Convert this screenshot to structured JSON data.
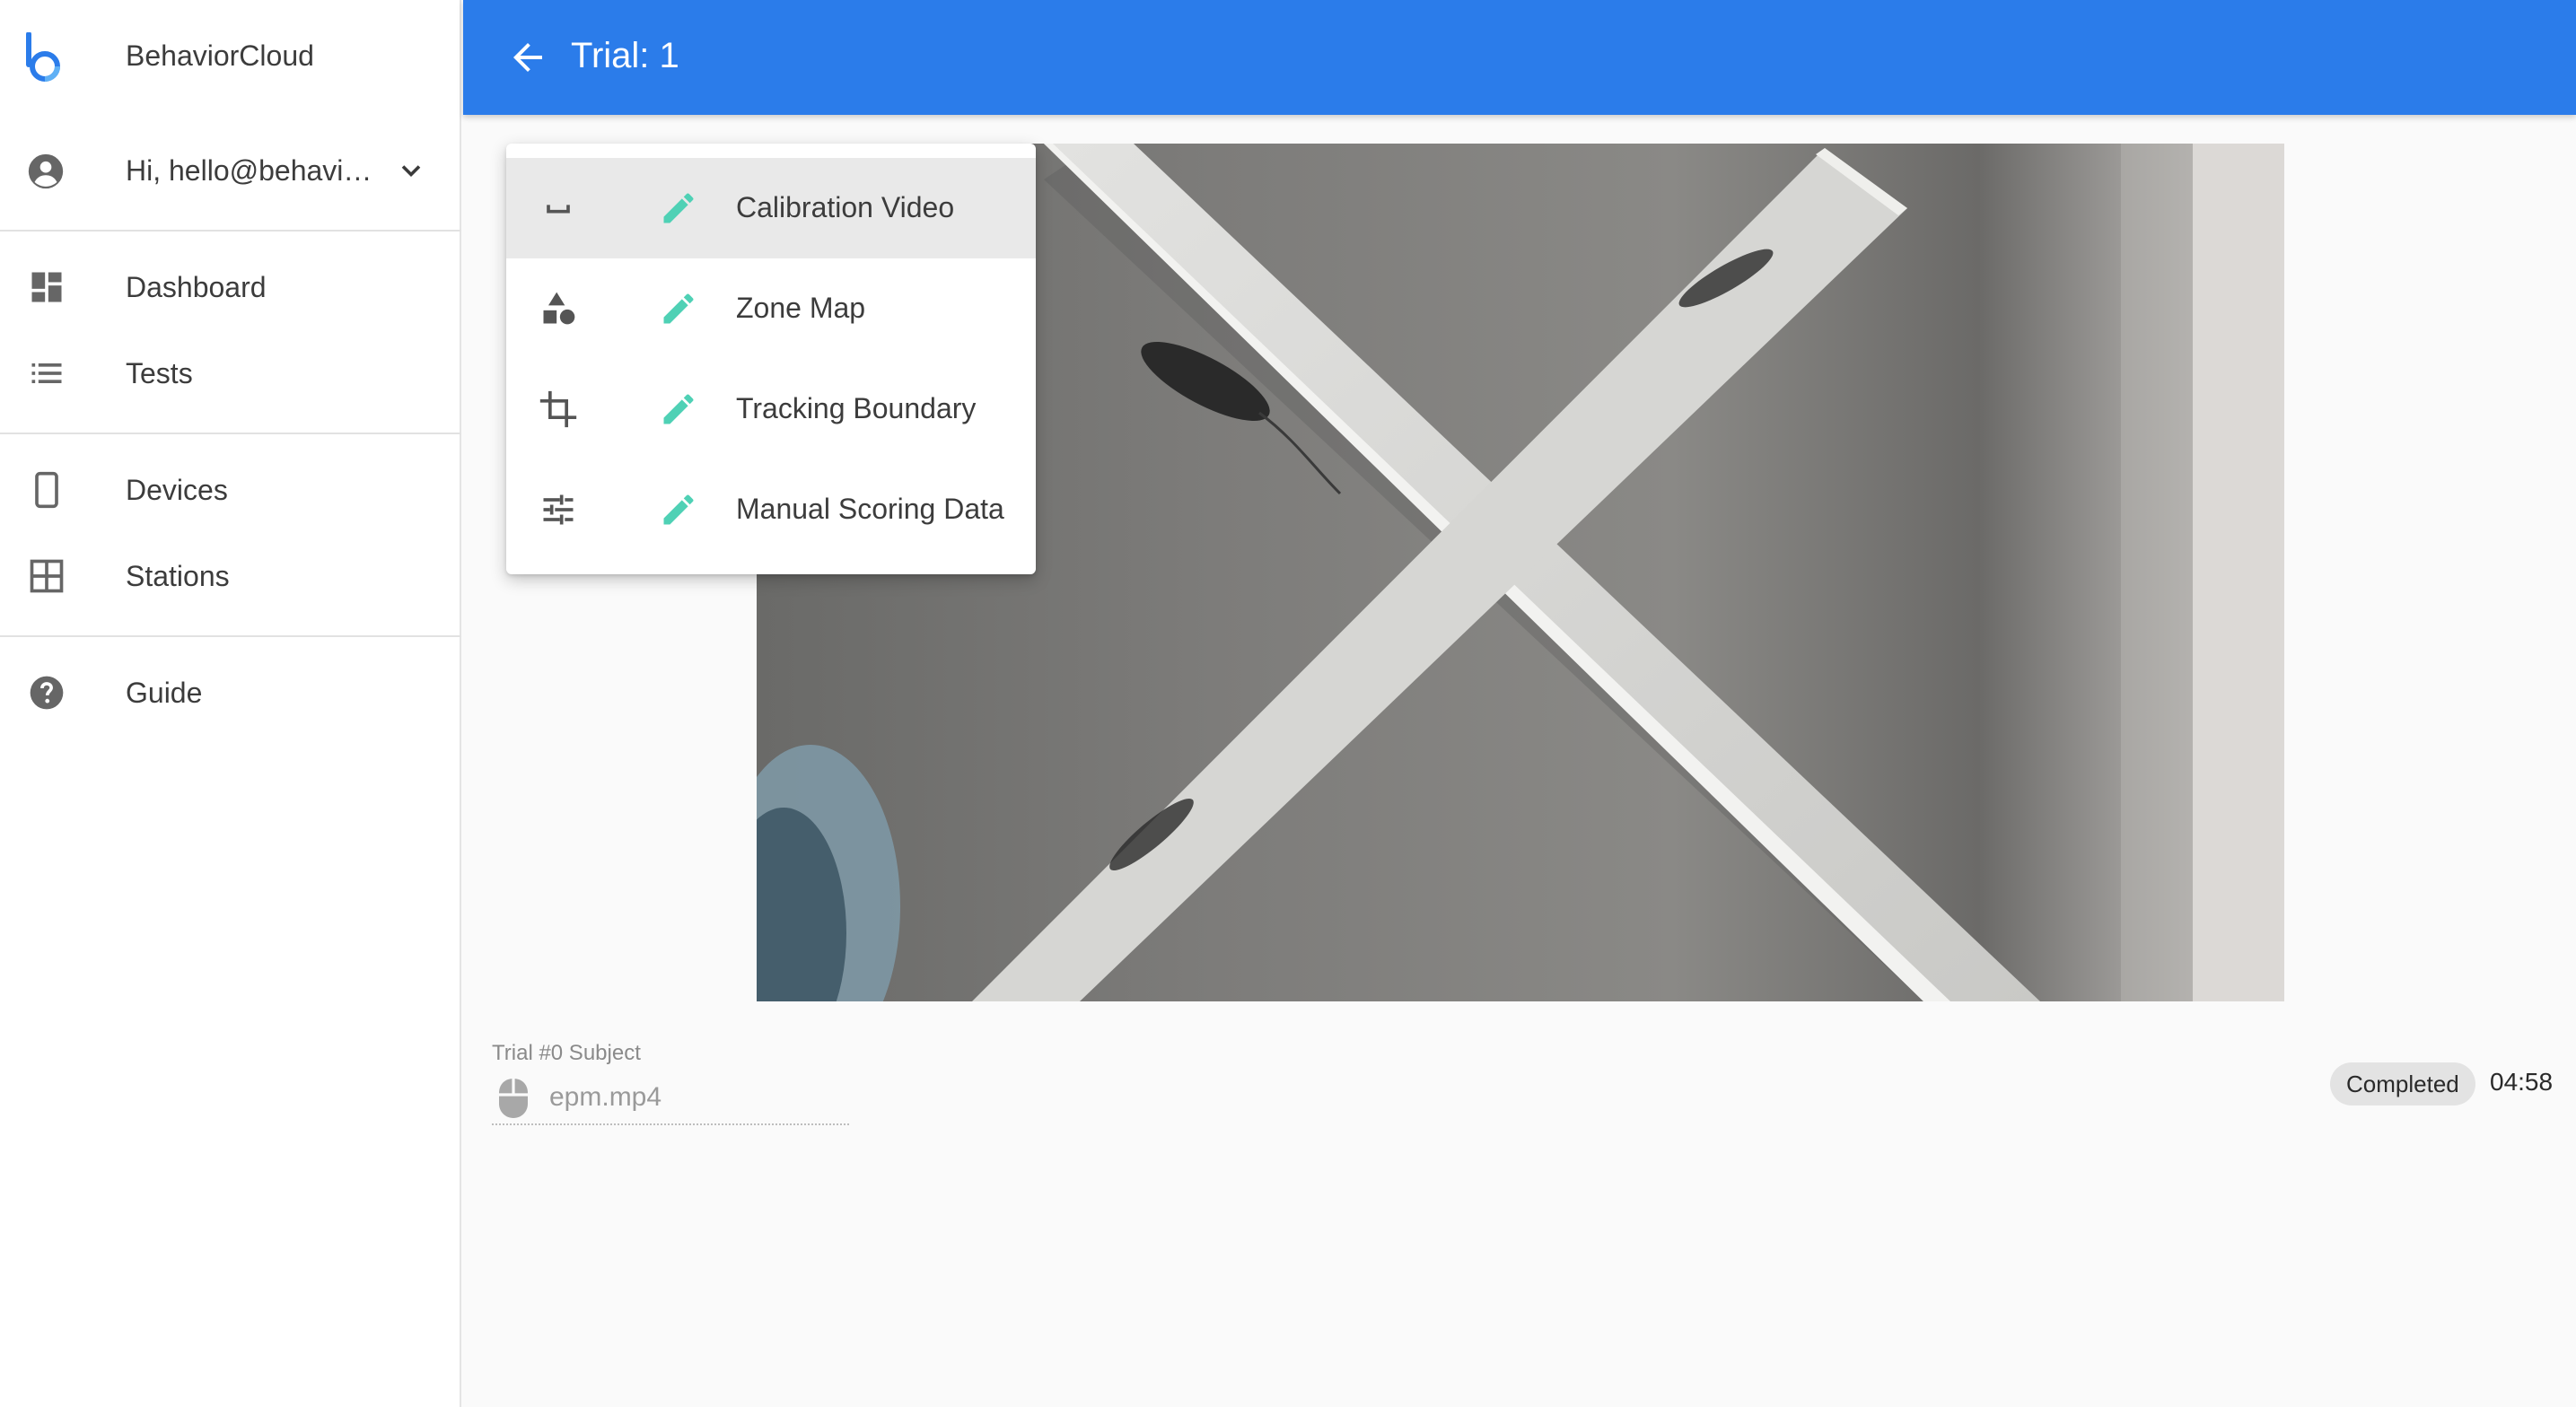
{
  "sidebar": {
    "brand": "BehaviorCloud",
    "user_label": "Hi, hello@behavior…",
    "items": [
      {
        "label": "Dashboard",
        "icon": "dashboard-icon"
      },
      {
        "label": "Tests",
        "icon": "list-icon"
      },
      {
        "label": "Devices",
        "icon": "phone-icon"
      },
      {
        "label": "Stations",
        "icon": "grid-icon"
      },
      {
        "label": "Guide",
        "icon": "help-icon"
      }
    ]
  },
  "header": {
    "title": "Trial: 1"
  },
  "menu": {
    "items": [
      {
        "label": "Calibration Video",
        "icon": "space-bar-icon"
      },
      {
        "label": "Zone Map",
        "icon": "shapes-icon"
      },
      {
        "label": "Tracking Boundary",
        "icon": "crop-icon"
      },
      {
        "label": "Manual Scoring Data",
        "icon": "tune-icon"
      }
    ]
  },
  "subject": {
    "label": "Trial #0 Subject",
    "value": "epm.mp4"
  },
  "status": {
    "badge": "Completed",
    "duration": "04:58"
  },
  "colors": {
    "appbar": "#2b7cea",
    "edit_icon": "#4fd1b5",
    "logo": "#2b7cea"
  }
}
